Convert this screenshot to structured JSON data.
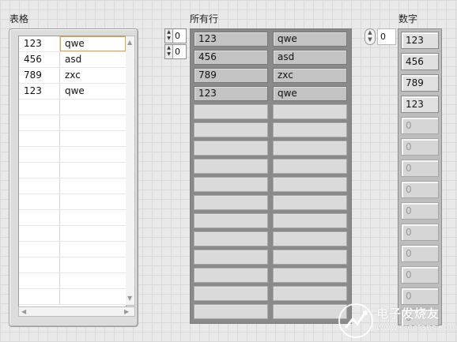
{
  "labels": {
    "table": "表格",
    "all_rows": "所有行",
    "numbers": "数字"
  },
  "table": {
    "rows": [
      [
        "123",
        "qwe"
      ],
      [
        "456",
        "asd"
      ],
      [
        "789",
        "zxc"
      ],
      [
        "123",
        "qwe"
      ]
    ]
  },
  "all_rows": {
    "index_row": "0",
    "index_col": "0",
    "rows": [
      [
        "123",
        "qwe"
      ],
      [
        "456",
        "asd"
      ],
      [
        "789",
        "zxc"
      ],
      [
        "123",
        "qwe"
      ]
    ]
  },
  "numbers": {
    "index": "0",
    "values": [
      "123",
      "456",
      "789",
      "123",
      "0",
      "0",
      "0",
      "0",
      "0",
      "0",
      "0",
      "0",
      "0",
      "0"
    ]
  },
  "watermark": {
    "line1": "电子发烧友",
    "line2": "www.elecfans.com"
  },
  "icons": [
    "spinner-icon",
    "scroll-up-arrow-icon",
    "scroll-down-arrow-icon",
    "scroll-left-arrow-icon",
    "scroll-right-arrow-icon",
    "elecfans-logo-icon"
  ]
}
